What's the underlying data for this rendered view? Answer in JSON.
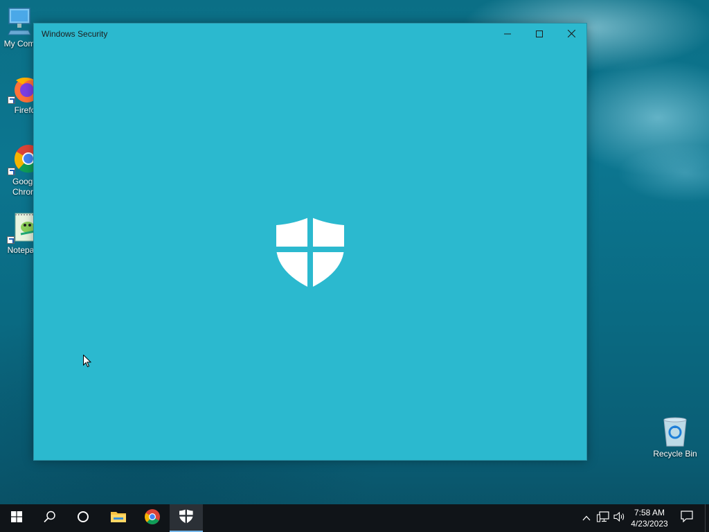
{
  "desktop": {
    "icons": [
      {
        "label": "My Com",
        "icon": "computer-icon"
      },
      {
        "label": "Firefo",
        "icon": "firefox-icon"
      },
      {
        "label": "Goog Chror",
        "icon": "chrome-icon"
      },
      {
        "label": "Notepa",
        "icon": "notepad-icon"
      },
      {
        "label": "Recycle Bin",
        "icon": "recycle-bin-icon"
      }
    ]
  },
  "window": {
    "title": "Windows Security",
    "controls": [
      "minimize",
      "maximize",
      "close"
    ],
    "background": "#2bb9cf",
    "splash_icon": "windows-security-shield-icon"
  },
  "taskbar": {
    "pinned": [
      {
        "name": "start",
        "icon": "windows-start-icon"
      },
      {
        "name": "search",
        "icon": "search-icon"
      },
      {
        "name": "cortana",
        "icon": "cortana-circle-icon"
      },
      {
        "name": "file-explorer",
        "icon": "folder-icon"
      },
      {
        "name": "chrome",
        "icon": "chrome-icon"
      },
      {
        "name": "windows-security",
        "icon": "shield-icon",
        "active": true
      }
    ],
    "tray": {
      "icons": [
        "chevron-up-icon",
        "network-icon",
        "volume-icon"
      ],
      "time": "7:58 AM",
      "date": "4/23/2023",
      "notification_icon": "action-center-icon"
    }
  }
}
